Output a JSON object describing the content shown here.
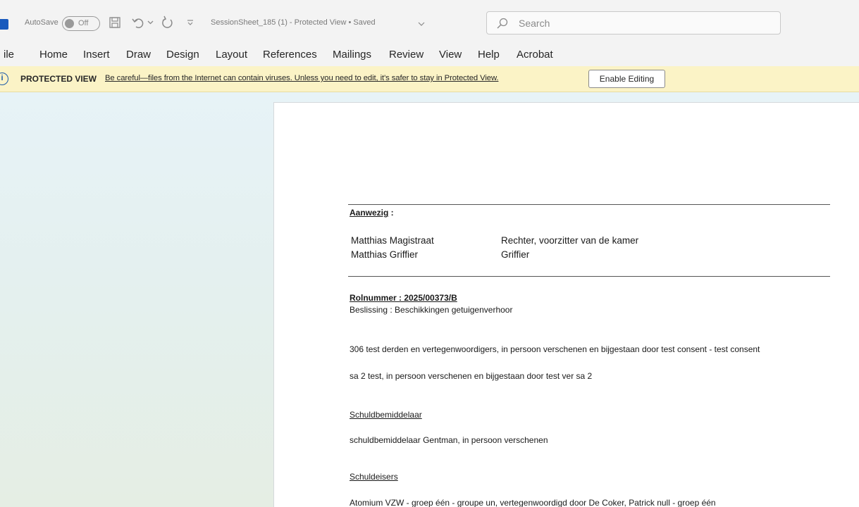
{
  "titlebar": {
    "autosave_label": "AutoSave",
    "autosave_state": "Off",
    "document_title": "SessionSheet_185 (1)  -  Protected View • Saved",
    "search_placeholder": "Search",
    "icons": [
      "word-app-icon",
      "save-icon",
      "undo-icon",
      "chevron-down-icon",
      "redo-icon",
      "customize-icon",
      "search-icon"
    ]
  },
  "ribbon": {
    "tabs": [
      "ile",
      "Home",
      "Insert",
      "Draw",
      "Design",
      "Layout",
      "References",
      "Mailings",
      "Review",
      "View",
      "Help",
      "Acrobat"
    ]
  },
  "protected_view": {
    "title": "PROTECTED VIEW",
    "message": "Be careful—files from the Internet can contain viruses. Unless you need to edit, it's safer to stay in Protected View.",
    "button": "Enable Editing",
    "info_glyph": "i"
  },
  "document": {
    "present_heading": "Aanwezig",
    "present_colon": " :",
    "present": [
      {
        "name": "Matthias Magistraat",
        "role": "Rechter, voorzitter van de kamer"
      },
      {
        "name": "Matthias Griffier",
        "role": "Griffier"
      }
    ],
    "case_number": "Rolnummer : 2025/00373/B",
    "decision": "Beslissing : Beschikkingen getuigenverhoor",
    "line1": "306 test derden en vertegenwoordigers, in persoon verschenen en bijgestaan door test consent - test consent",
    "line2": "sa 2 test, in persoon verschenen en bijgestaan door test ver sa 2",
    "mediator_heading": "Schuldbemiddelaar",
    "mediator_line": "schuldbemiddelaar Gentman, in persoon verschenen",
    "creditors_heading": "Schuldeisers",
    "creditors_line": "Atomium VZW - groep één - groupe un, vertegenwoordigd door De Coker, Patrick null - groep één"
  }
}
